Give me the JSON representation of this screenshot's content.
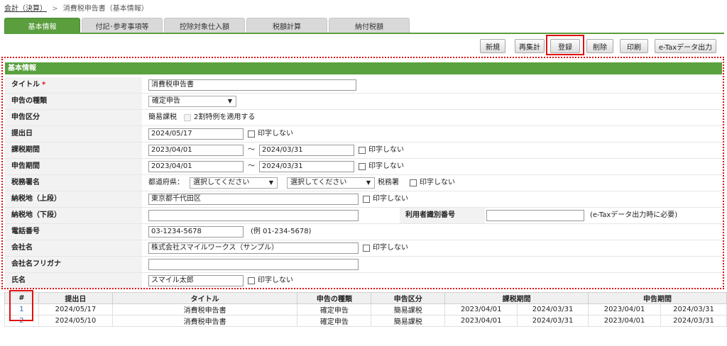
{
  "breadcrumb": {
    "parent": "会計（決算）",
    "separator": ">",
    "current": "消費税申告書（基本情報）"
  },
  "tabs": [
    "基本情報",
    "付記･参考事項等",
    "控除対象仕入額",
    "税額計算",
    "納付税額"
  ],
  "toolbar": {
    "new": "新規",
    "recount": "再集計",
    "register": "登録",
    "delete": "削除",
    "print": "印刷",
    "etax": "e-Taxデータ出力"
  },
  "form": {
    "section_title": "基本情報",
    "title": {
      "label": "タイトル",
      "required_mark": "*",
      "value": "消費税申告書"
    },
    "kind": {
      "label": "申告の種類",
      "value": "確定申告"
    },
    "category": {
      "label": "申告区分",
      "value": "簡易課税",
      "special": "2割特例を適用する"
    },
    "submit_date": {
      "label": "提出日",
      "value": "2024/05/17",
      "noprint": "印字しない"
    },
    "tax_period": {
      "label": "課税期間",
      "from": "2023/04/01",
      "tilde": "～",
      "to": "2024/03/31",
      "noprint": "印字しない"
    },
    "report_period": {
      "label": "申告期間",
      "from": "2023/04/01",
      "tilde": "～",
      "to": "2024/03/31",
      "noprint": "印字しない"
    },
    "tax_office": {
      "label": "税務署名",
      "pref_label": "都道府県：",
      "pref_placeholder": "選択してください",
      "office_placeholder": "選択してください",
      "suffix": "税務署",
      "noprint": "印字しない"
    },
    "address_upper": {
      "label": "納税地（上段）",
      "value": "東京都千代田区",
      "noprint": "印字しない"
    },
    "address_lower": {
      "label": "納税地（下段）",
      "value": "",
      "user_id_label": "利用者識別番号",
      "user_id_value": "",
      "user_id_note": "(e-Taxデータ出力時に必要)"
    },
    "phone": {
      "label": "電話番号",
      "value": "03-1234-5678",
      "example": "(例 01-234-5678)"
    },
    "company": {
      "label": "会社名",
      "value": "株式会社スマイルワークス（サンプル）",
      "noprint": "印字しない"
    },
    "company_kana": {
      "label": "会社名フリガナ",
      "value": ""
    },
    "person": {
      "label": "氏名",
      "value": "スマイル太郎",
      "noprint": "印字しない"
    }
  },
  "records": {
    "headers": [
      "#",
      "提出日",
      "タイトル",
      "申告の種類",
      "申告区分",
      "課税期間",
      "申告期間"
    ],
    "rows": [
      {
        "no": "1",
        "date": "2024/05/17",
        "title": "消費税申告書",
        "kind": "確定申告",
        "category": "簡易課税",
        "tax_from": "2023/04/01",
        "tax_to": "2024/03/31",
        "rep_from": "2023/04/01",
        "rep_to": "2024/03/31"
      },
      {
        "no": "2",
        "date": "2024/05/10",
        "title": "消費税申告書",
        "kind": "確定申告",
        "category": "簡易課税",
        "tax_from": "2023/04/01",
        "tax_to": "2024/03/31",
        "rep_from": "2023/04/01",
        "rep_to": "2024/03/31"
      }
    ]
  },
  "colors": {
    "accent_green": "#5aa13f",
    "highlight_red": "#e01010",
    "link_blue": "#2a6dbf"
  }
}
